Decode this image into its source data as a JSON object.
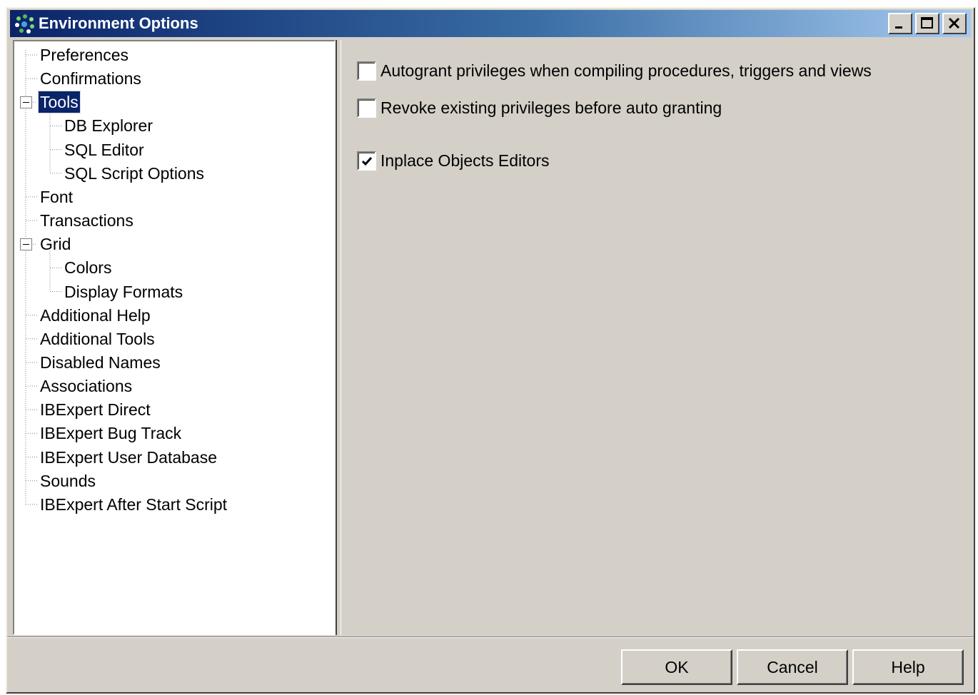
{
  "window": {
    "title": "Environment Options",
    "icon": "ibexpert-app-icon",
    "controls": [
      "minimize-icon",
      "maximize-icon",
      "close-icon"
    ]
  },
  "tree": {
    "items": [
      {
        "label": "Preferences",
        "level": 0
      },
      {
        "label": "Confirmations",
        "level": 0
      },
      {
        "label": "Tools",
        "level": 0,
        "expanded": true,
        "selected": true
      },
      {
        "label": "DB Explorer",
        "level": 1
      },
      {
        "label": "SQL Editor",
        "level": 1
      },
      {
        "label": "SQL Script Options",
        "level": 1
      },
      {
        "label": "Font",
        "level": 0
      },
      {
        "label": "Transactions",
        "level": 0
      },
      {
        "label": "Grid",
        "level": 0,
        "expanded": true
      },
      {
        "label": "Colors",
        "level": 1
      },
      {
        "label": "Display Formats",
        "level": 1
      },
      {
        "label": "Additional Help",
        "level": 0
      },
      {
        "label": "Additional Tools",
        "level": 0
      },
      {
        "label": "Disabled Names",
        "level": 0
      },
      {
        "label": "Associations",
        "level": 0
      },
      {
        "label": "IBExpert Direct",
        "level": 0
      },
      {
        "label": "IBExpert Bug Track",
        "level": 0
      },
      {
        "label": "IBExpert User Database",
        "level": 0
      },
      {
        "label": "Sounds",
        "level": 0
      },
      {
        "label": "IBExpert After Start Script",
        "level": 0
      }
    ]
  },
  "options": [
    {
      "label": "Autogrant privileges when compiling procedures, triggers and views",
      "checked": false
    },
    {
      "label": "Revoke existing privileges before auto granting",
      "checked": false
    },
    {
      "label": "Inplace Objects Editors",
      "checked": true
    }
  ],
  "buttons": {
    "ok": "OK",
    "cancel": "Cancel",
    "help": "Help"
  },
  "colors": {
    "selection": "#0a246a",
    "face": "#d4d0c8"
  }
}
